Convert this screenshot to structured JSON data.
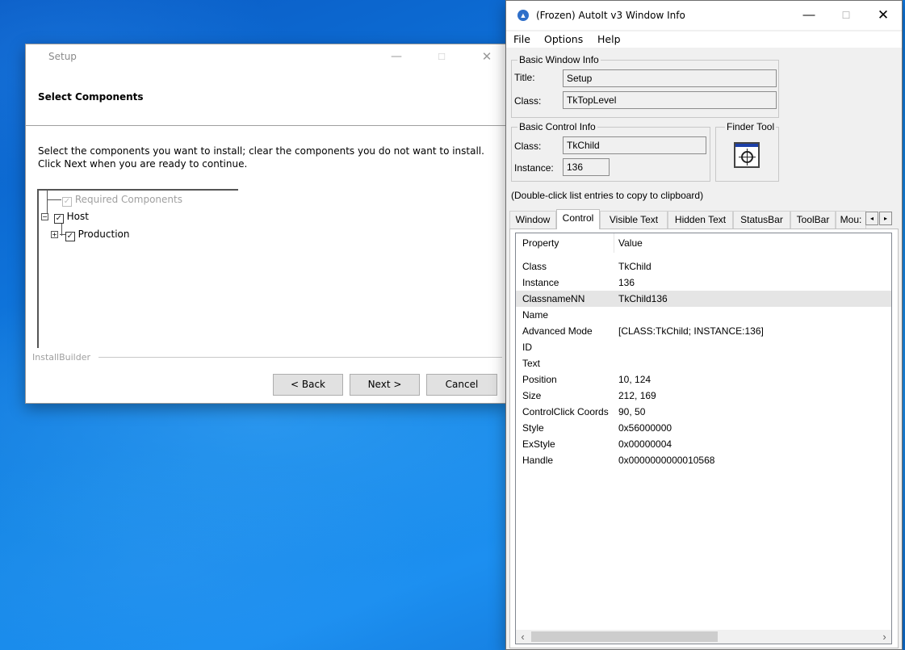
{
  "setup": {
    "title": "Setup",
    "header_title": "Select Components",
    "description": "Select the components you want to install; clear the components you do not want to install. Click Next when you are ready to continue.",
    "tree": [
      {
        "label": "Required Components",
        "checked": true,
        "disabled": true
      },
      {
        "label": "Host",
        "checked": true,
        "disabled": false,
        "expander": "minus"
      },
      {
        "label": "Production",
        "checked": true,
        "disabled": false,
        "expander": "plus"
      }
    ],
    "brand_label": "InstallBuilder",
    "buttons": {
      "back": "< Back",
      "next": "Next >",
      "cancel": "Cancel"
    },
    "caption": {
      "minimize": "—",
      "maximize": "☐",
      "close": "✕"
    },
    "check_glyph": "✓"
  },
  "autoit": {
    "title": "(Frozen) AutoIt v3 Window Info",
    "caption": {
      "minimize": "—",
      "maximize": "☐",
      "close": "✕"
    },
    "menu": [
      "File",
      "Options",
      "Help"
    ],
    "basic_window_info": {
      "group_label": "Basic Window Info",
      "title_label": "Title:",
      "title_value": "Setup",
      "class_label": "Class:",
      "class_value": "TkTopLevel"
    },
    "basic_control_info": {
      "group_label": "Basic Control Info",
      "class_label": "Class:",
      "class_value": "TkChild",
      "instance_label": "Instance:",
      "instance_value": "136"
    },
    "finder_tool": {
      "group_label": "Finder Tool"
    },
    "hint": "(Double-click list entries to copy to clipboard)",
    "tabs": [
      "Window",
      "Control",
      "Visible Text",
      "Hidden Text",
      "StatusBar",
      "ToolBar",
      "Mou:"
    ],
    "active_tab": "Control",
    "tab_scroll": {
      "left": "◂",
      "right": "▸"
    },
    "list": {
      "columns": [
        "Property",
        "Value"
      ],
      "rows": [
        {
          "property": "Class",
          "value": "TkChild"
        },
        {
          "property": "Instance",
          "value": "136"
        },
        {
          "property": "ClassnameNN",
          "value": "TkChild136",
          "selected": true
        },
        {
          "property": "Name",
          "value": ""
        },
        {
          "property": "Advanced Mode",
          "value": "[CLASS:TkChild; INSTANCE:136]"
        },
        {
          "property": "ID",
          "value": ""
        },
        {
          "property": "Text",
          "value": ""
        },
        {
          "property": "Position",
          "value": "10, 124"
        },
        {
          "property": "Size",
          "value": "212, 169"
        },
        {
          "property": "ControlClick Coords",
          "value": "90, 50"
        },
        {
          "property": "Style",
          "value": "0x56000000"
        },
        {
          "property": "ExStyle",
          "value": "0x00000004"
        },
        {
          "property": "Handle",
          "value": "0x0000000000010568"
        }
      ]
    },
    "scroll_arrows": {
      "left": "‹",
      "right": "›"
    }
  }
}
